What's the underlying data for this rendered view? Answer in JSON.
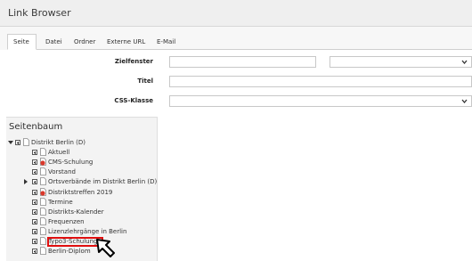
{
  "header": {
    "title": "Link Browser"
  },
  "tabs": [
    {
      "label": "Seite",
      "active": true
    },
    {
      "label": "Datei",
      "active": false
    },
    {
      "label": "Ordner",
      "active": false
    },
    {
      "label": "Externe URL",
      "active": false
    },
    {
      "label": "E-Mail",
      "active": false
    }
  ],
  "form": {
    "zielfenster_label": "Zielfenster",
    "zielfenster_value": "",
    "zielfenster_select_value": "",
    "titel_label": "Titel",
    "titel_value": "",
    "css_klasse_label": "CSS-Klasse",
    "css_klasse_value": ""
  },
  "tree": {
    "title": "Seitenbaum",
    "items": [
      {
        "label": "Distrikt Berlin (D)",
        "icon": "page-icon",
        "expanded": true,
        "level": 0
      },
      {
        "label": "Aktuell",
        "icon": "page-icon",
        "level": 1
      },
      {
        "label": "CMS-Schulung",
        "icon": "page-restricted-icon",
        "level": 1
      },
      {
        "label": "Vorstand",
        "icon": "page-icon",
        "level": 1
      },
      {
        "label": "Ortsverbände im Distrikt Berlin (D)",
        "icon": "page-icon",
        "level": 1,
        "has_children": true
      },
      {
        "label": "Distriktstreffen 2019",
        "icon": "page-restricted-icon",
        "level": 1
      },
      {
        "label": "Termine",
        "icon": "page-icon",
        "level": 1
      },
      {
        "label": "Distrikts-Kalender",
        "icon": "page-icon",
        "level": 1
      },
      {
        "label": "Frequenzen",
        "icon": "page-icon",
        "level": 1
      },
      {
        "label": "Lizenzlehrgänge in Berlin",
        "icon": "page-icon",
        "level": 1
      },
      {
        "label": "Typo3-Schulung",
        "icon": "page-icon",
        "level": 1,
        "highlighted": true
      },
      {
        "label": "Berlin-Diplom",
        "icon": "page-icon",
        "level": 1
      }
    ]
  },
  "colors": {
    "highlight": "#e01010",
    "restricted": "#d9382b"
  }
}
